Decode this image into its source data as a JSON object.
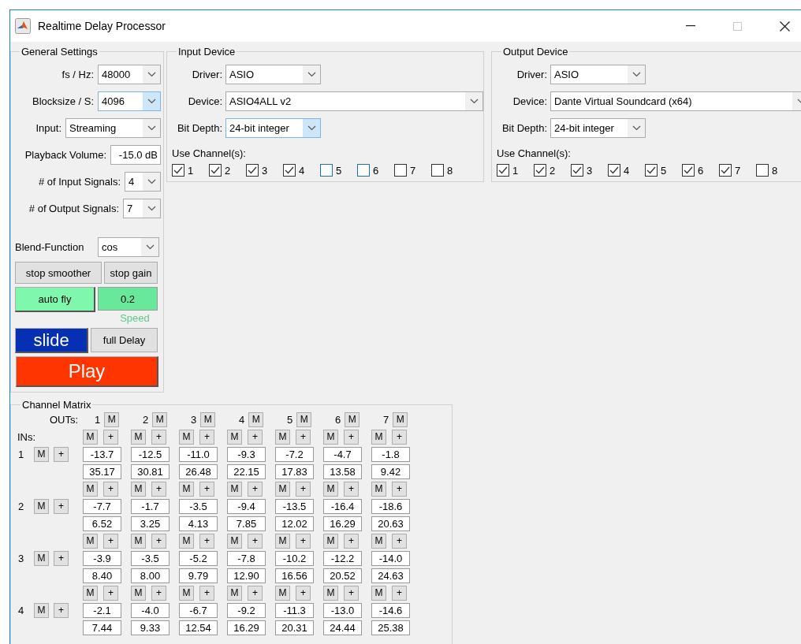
{
  "window": {
    "title": "Realtime Delay Processor",
    "maximize_disabled": true
  },
  "general_settings": {
    "title": "General Settings",
    "fields": [
      {
        "kind": "dropdown",
        "label": "fs / Hz:",
        "value": "48000"
      },
      {
        "kind": "dropdown",
        "label": "Blocksize / S:",
        "value": "4096",
        "hovered": true
      },
      {
        "kind": "dropdown",
        "label": "Input:",
        "value": "Streaming"
      },
      {
        "kind": "text",
        "label": "Playback Volume:",
        "value": "-15.0 dB"
      },
      {
        "kind": "dropdown",
        "label": "# of Input Signals:",
        "value": "4"
      },
      {
        "kind": "dropdown",
        "label": "# of Output Signals:",
        "value": "7"
      }
    ],
    "blend_function": {
      "label": "Blend-Function",
      "value": "cos"
    },
    "stop_smoother": "stop smoother",
    "stop_gain": "stop gain",
    "auto_fly": "auto fly",
    "speed_value": "0.2",
    "speed_label": "Speed",
    "slide": "slide",
    "full_delay": "full Delay",
    "play": "Play"
  },
  "input_device": {
    "title": "Input Device",
    "driver": {
      "label": "Driver:",
      "value": "ASIO"
    },
    "device": {
      "label": "Device:",
      "value": "ASIO4ALL v2"
    },
    "bit_depth": {
      "label": "Bit Depth:",
      "value": "24-bit integer",
      "hovered": true
    },
    "channels_label": "Use Channel(s):",
    "channels": [
      {
        "label": "1",
        "checked": true,
        "focused": false
      },
      {
        "label": "2",
        "checked": true,
        "focused": false
      },
      {
        "label": "3",
        "checked": true,
        "focused": false
      },
      {
        "label": "4",
        "checked": true,
        "focused": false
      },
      {
        "label": "5",
        "checked": false,
        "focused": true
      },
      {
        "label": "6",
        "checked": false,
        "focused": true
      },
      {
        "label": "7",
        "checked": false,
        "focused": false
      },
      {
        "label": "8",
        "checked": false,
        "focused": false
      }
    ]
  },
  "output_device": {
    "title": "Output Device",
    "driver": {
      "label": "Driver:",
      "value": "ASIO"
    },
    "device": {
      "label": "Device:",
      "value": "Dante Virtual Soundcard (x64)"
    },
    "bit_depth": {
      "label": "Bit Depth:",
      "value": "24-bit integer"
    },
    "channels_label": "Use Channel(s):",
    "channels": [
      {
        "label": "1",
        "checked": true,
        "focused": false
      },
      {
        "label": "2",
        "checked": true,
        "focused": false
      },
      {
        "label": "3",
        "checked": true,
        "focused": false
      },
      {
        "label": "4",
        "checked": true,
        "focused": false
      },
      {
        "label": "5",
        "checked": true,
        "focused": false
      },
      {
        "label": "6",
        "checked": true,
        "focused": false
      },
      {
        "label": "7",
        "checked": true,
        "focused": false
      },
      {
        "label": "8",
        "checked": false,
        "focused": false
      }
    ]
  },
  "channel_matrix": {
    "title": "Channel Matrix",
    "outs_label": "OUTs:",
    "ins_label": "INs:",
    "outs": [
      {
        "label": "1",
        "mute": "M"
      },
      {
        "label": "2",
        "mute": "M"
      },
      {
        "label": "3",
        "mute": "M"
      },
      {
        "label": "4",
        "mute": "M"
      },
      {
        "label": "5",
        "mute": "M"
      },
      {
        "label": "6",
        "mute": "M"
      },
      {
        "label": "7",
        "mute": "M"
      }
    ],
    "rows": [
      {
        "label": "1",
        "mute": "M",
        "add": "+",
        "cells": [
          {
            "mute": "M",
            "add": "+",
            "gain": "-13.7",
            "delay": "35.17"
          },
          {
            "mute": "M",
            "add": "+",
            "gain": "-12.5",
            "delay": "30.81"
          },
          {
            "mute": "M",
            "add": "+",
            "gain": "-11.0",
            "delay": "26.48"
          },
          {
            "mute": "M",
            "add": "+",
            "gain": "-9.3",
            "delay": "22.15"
          },
          {
            "mute": "M",
            "add": "+",
            "gain": "-7.2",
            "delay": "17.83"
          },
          {
            "mute": "M",
            "add": "+",
            "gain": "-4.7",
            "delay": "13.58"
          },
          {
            "mute": "M",
            "add": "+",
            "gain": "-1.8",
            "delay": "9.42"
          }
        ]
      },
      {
        "label": "2",
        "mute": "M",
        "add": "+",
        "cells": [
          {
            "mute": "M",
            "add": "+",
            "gain": "-7.7",
            "delay": "6.52"
          },
          {
            "mute": "M",
            "add": "+",
            "gain": "-1.7",
            "delay": "3.25"
          },
          {
            "mute": "M",
            "add": "+",
            "gain": "-3.5",
            "delay": "4.13"
          },
          {
            "mute": "M",
            "add": "+",
            "gain": "-9.4",
            "delay": "7.85"
          },
          {
            "mute": "M",
            "add": "+",
            "gain": "-13.5",
            "delay": "12.02"
          },
          {
            "mute": "M",
            "add": "+",
            "gain": "-16.4",
            "delay": "16.29"
          },
          {
            "mute": "M",
            "add": "+",
            "gain": "-18.6",
            "delay": "20.63"
          }
        ]
      },
      {
        "label": "3",
        "mute": "M",
        "add": "+",
        "cells": [
          {
            "mute": "M",
            "add": "+",
            "gain": "-3.9",
            "delay": "8.40"
          },
          {
            "mute": "M",
            "add": "+",
            "gain": "-3.5",
            "delay": "8.00"
          },
          {
            "mute": "M",
            "add": "+",
            "gain": "-5.2",
            "delay": "9.79"
          },
          {
            "mute": "M",
            "add": "+",
            "gain": "-7.8",
            "delay": "12.90"
          },
          {
            "mute": "M",
            "add": "+",
            "gain": "-10.2",
            "delay": "16.56"
          },
          {
            "mute": "M",
            "add": "+",
            "gain": "-12.2",
            "delay": "20.52"
          },
          {
            "mute": "M",
            "add": "+",
            "gain": "-14.0",
            "delay": "24.63"
          }
        ]
      },
      {
        "label": "4",
        "mute": "M",
        "add": "+",
        "cells": [
          {
            "mute": "M",
            "add": "+",
            "gain": "-2.1",
            "delay": "7.44"
          },
          {
            "mute": "M",
            "add": "+",
            "gain": "-4.0",
            "delay": "9.33"
          },
          {
            "mute": "M",
            "add": "+",
            "gain": "-6.7",
            "delay": "12.54"
          },
          {
            "mute": "M",
            "add": "+",
            "gain": "-9.2",
            "delay": "16.29"
          },
          {
            "mute": "M",
            "add": "+",
            "gain": "-11.3",
            "delay": "20.31"
          },
          {
            "mute": "M",
            "add": "+",
            "gain": "-13.0",
            "delay": "24.44"
          },
          {
            "mute": "M",
            "add": "+",
            "gain": "-14.6",
            "delay": "25.38"
          }
        ]
      }
    ]
  }
}
